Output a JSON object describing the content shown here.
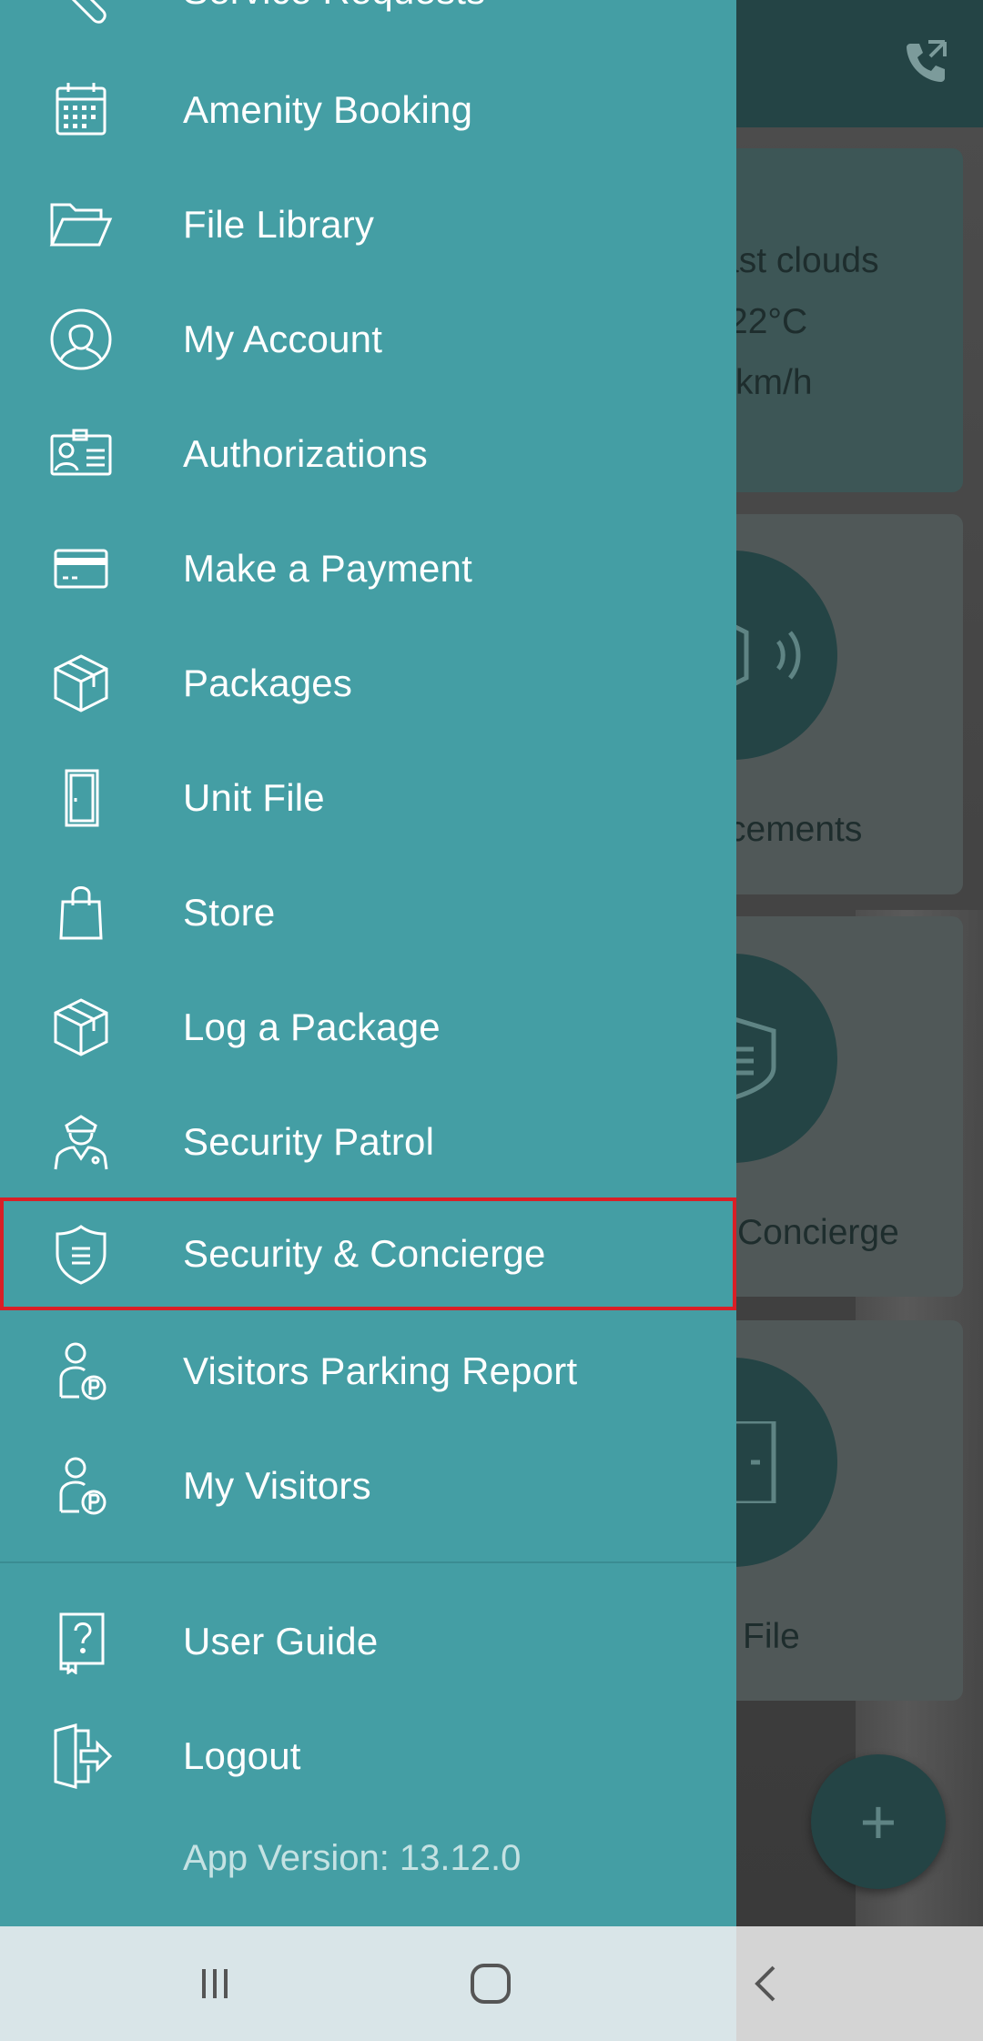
{
  "background": {
    "weather_lines": [
      "ast clouds",
      "22°C",
      "km/h"
    ],
    "card2_label": "cements",
    "card3_label": " Concierge",
    "card4_label": "File",
    "fab_symbol": "+",
    "phone_icon": "phone-icon"
  },
  "drawer": {
    "partial_top_item": "Service Requests",
    "items": [
      {
        "label": "Amenity Booking",
        "icon": "calendar-icon"
      },
      {
        "label": "File Library",
        "icon": "folder-icon"
      },
      {
        "label": "My Account",
        "icon": "user-circle-icon"
      },
      {
        "label": "Authorizations",
        "icon": "id-card-icon"
      },
      {
        "label": "Make a Payment",
        "icon": "credit-card-icon"
      },
      {
        "label": "Packages",
        "icon": "package-icon"
      },
      {
        "label": "Unit File",
        "icon": "door-icon"
      },
      {
        "label": "Store",
        "icon": "shopping-bag-icon"
      },
      {
        "label": "Log a Package",
        "icon": "package-icon"
      },
      {
        "label": "Security Patrol",
        "icon": "security-guard-icon"
      },
      {
        "label": "Security & Concierge",
        "icon": "shield-icon",
        "highlighted": true
      },
      {
        "label": "Visitors Parking Report",
        "icon": "visitor-parking-icon"
      },
      {
        "label": "My Visitors",
        "icon": "visitor-parking-icon"
      }
    ],
    "bottom_items": [
      {
        "label": "User Guide",
        "icon": "user-guide-icon"
      },
      {
        "label": "Logout",
        "icon": "logout-icon"
      }
    ],
    "app_version": "App Version: 13.12.0"
  },
  "colors": {
    "drawer_bg": "#449ea4",
    "highlight_border": "#d91f26",
    "header_bg": "#244445"
  },
  "navbar": {
    "buttons": [
      "recent-apps-icon",
      "home-icon",
      "back-icon"
    ]
  }
}
